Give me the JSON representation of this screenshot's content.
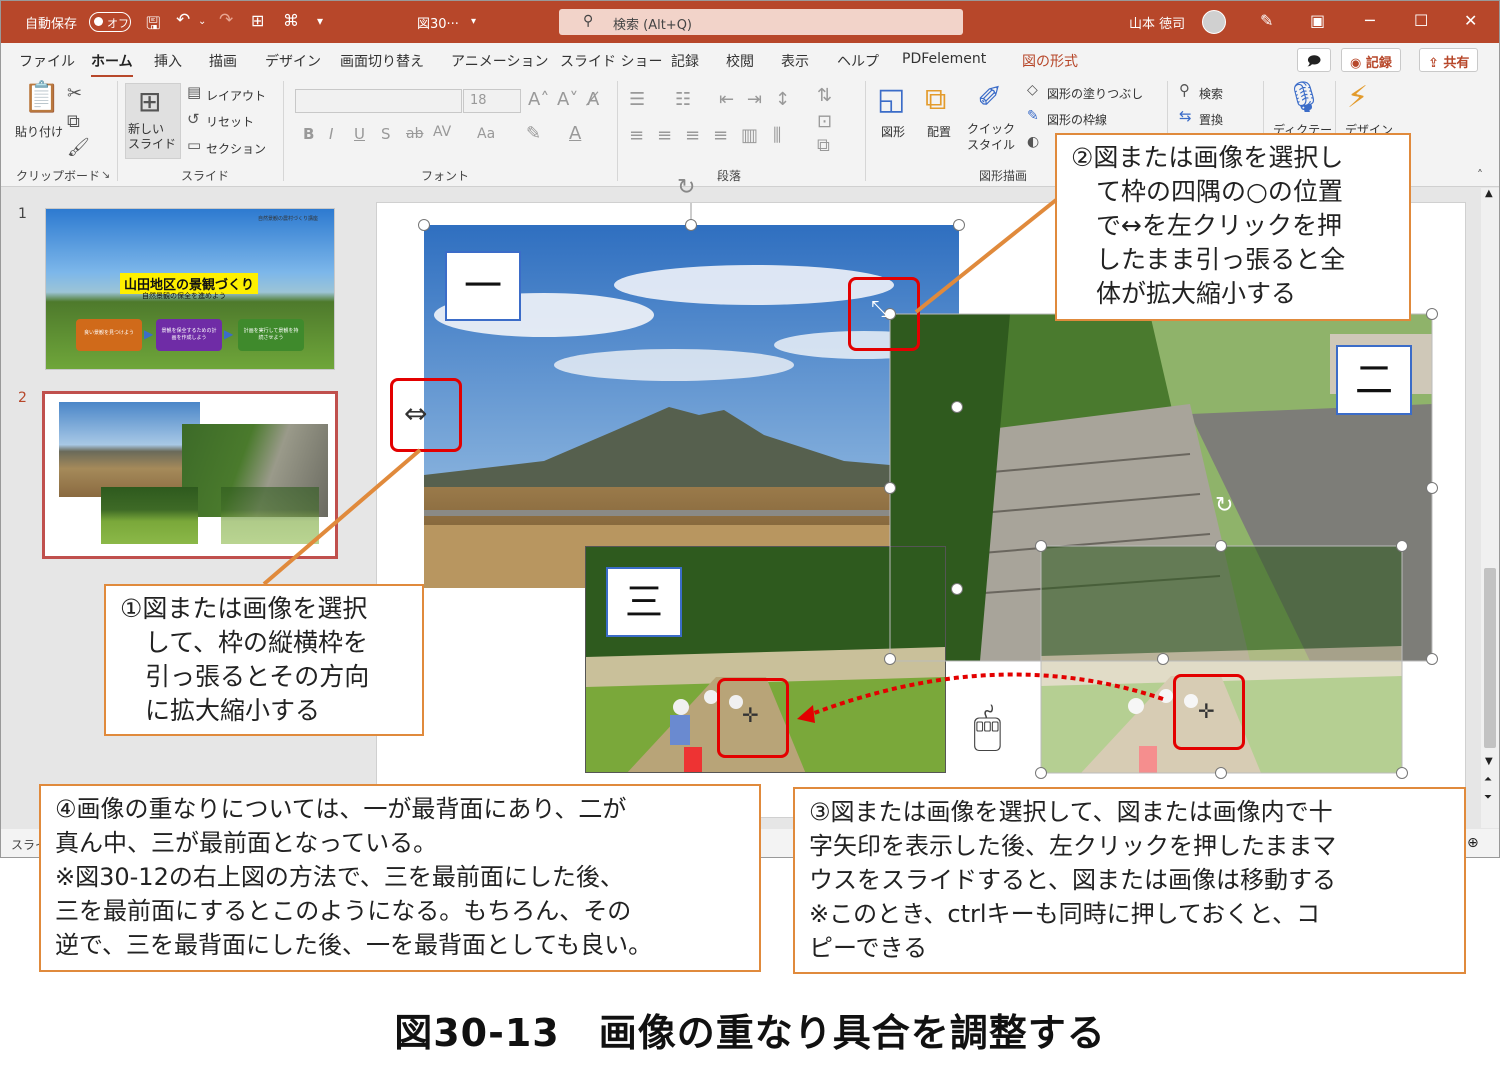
{
  "titlebar": {
    "autosave_label": "自動保存",
    "autosave_state": "オフ",
    "file_name": "図30···",
    "search_placeholder": "検索 (Alt+Q)",
    "user_name": "山本 徳司"
  },
  "tabs": [
    "ファイル",
    "ホーム",
    "挿入",
    "描画",
    "デザイン",
    "画面切り替え",
    "アニメーション",
    "スライド ショー",
    "記録",
    "校閲",
    "表示",
    "ヘルプ",
    "PDFelement",
    "図の形式"
  ],
  "tab_buttons": {
    "record": "記録",
    "share": "共有"
  },
  "ribbon": {
    "clipboard": {
      "paste": "貼り付け",
      "group": "クリップボード"
    },
    "slides": {
      "new_slide": "新しい\nスライド",
      "layout": "レイアウト",
      "reset": "リセット",
      "section": "セクション",
      "group": "スライド"
    },
    "font": {
      "size": "18",
      "group": "フォント"
    },
    "paragraph": {
      "group": "段落"
    },
    "drawing": {
      "shape": "図形",
      "arrange": "配置",
      "quick_style": "クイック\nスタイル",
      "fill": "図形の塗りつぶし",
      "outline": "図形の枠線",
      "group": "図形描画"
    },
    "editing": {
      "find": "検索",
      "replace": "置換"
    },
    "voice": {
      "dictate": "ディクテー"
    },
    "designer": {
      "label": "デザイン"
    }
  },
  "thumbnails": [
    {
      "number": "1",
      "title": "山田地区の景観づくり",
      "subtitle": "自然景観の保全を進めよう",
      "header": "自然景観の農村づくり講座",
      "boxes": [
        "良い景観を見つけよう",
        "景観を保全するための計画を作成しよう",
        "計画を実行して景観を持続させよう"
      ]
    },
    {
      "number": "2"
    }
  ],
  "slide": {
    "labels": {
      "first": "一",
      "second": "二",
      "third": "三",
      "third_copy": "三"
    }
  },
  "callouts": {
    "c1": "①図または画像を選択\n　して、枠の縦横枠を\n　引っ張るとその方向\n　に拡大縮小する",
    "c2": "②図または画像を選択し\n　て枠の四隅の○の位置\n　で↔を左クリックを押\n　したまま引っ張ると全\n　体が拡大縮小する",
    "c3": "③図または画像を選択して、図または画像内で十\n字矢印を表示した後、左クリックを押したままマ\nウスをスライドすると、図または画像は移動する\n※このとき、ctrlキーも同時に押しておくと、コ\nピーできる",
    "c4": "④画像の重なりについては、一が最背面にあり、二が\n真ん中、三が最前面となっている。\n※図30-12の右上図の方法で、三を最前面にした後、\n三を最前面にするとこのようになる。もちろん、その\n逆で、三を最背面にした後、一を最背面としても良い。"
  },
  "status": {
    "left": "スライ"
  },
  "caption": "図30-13　画像の重なり具合を調整する",
  "colors": {
    "accent": "#b7472a",
    "callout_border": "#e08a3c",
    "highlight": "#e30000",
    "label_border": "#3b6cc8"
  }
}
